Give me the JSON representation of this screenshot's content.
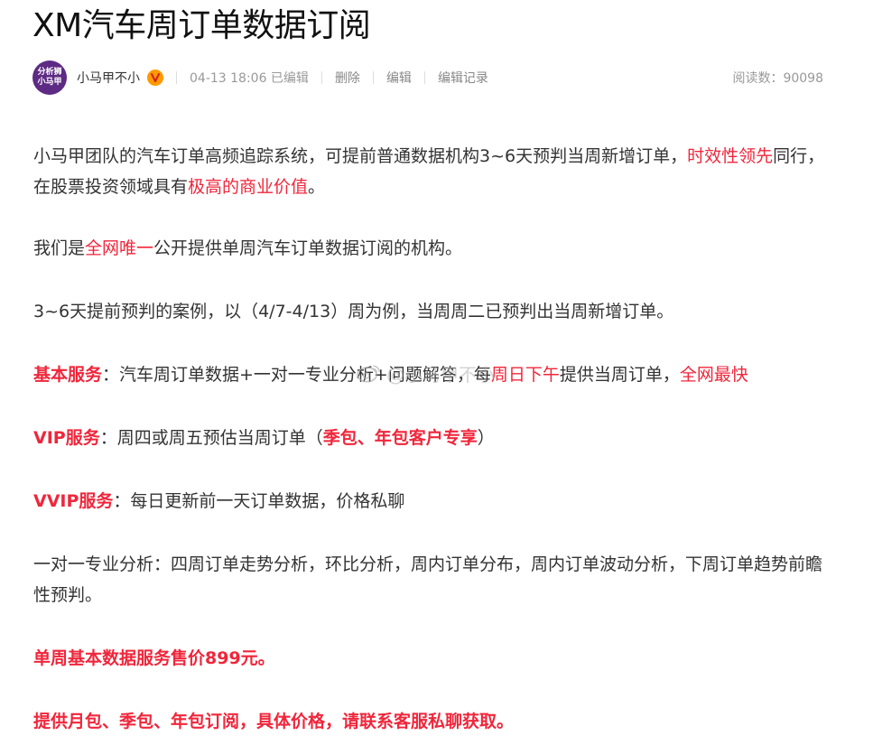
{
  "article": {
    "title": "XM汽车周订单数据订阅",
    "author": {
      "avatar_line1": "分析狮",
      "avatar_line2": "小马甲",
      "name": "小马甲不小"
    },
    "meta": {
      "date_status": "04-13 18:06 已编辑",
      "delete_label": "删除",
      "edit_label": "编辑",
      "history_label": "编辑记录",
      "read_count": "阅读数：90098"
    },
    "paragraph_1": {
      "part1": "小马甲团队的汽车订单高频追踪系统，可提前普通数据机构3~6天预判当周新增订单，",
      "highlight1": "时效性领先",
      "part2": "同行，在股票投资领域具有",
      "highlight2": "极高的商业价值",
      "part3": "。"
    },
    "paragraph_2": {
      "part1": "我们是",
      "highlight": "全网唯一",
      "part2": "公开提供单周汽车订单数据订阅的机构。"
    },
    "paragraph_3": {
      "text": "3~6天提前预判的案例，以（4/7-4/13）周为例，当周周二已预判出当周新增订单。"
    },
    "paragraph_4": {
      "label": "基本服务",
      "part1": "：汽车周订单数据+一对一专业分析+问题解答，每",
      "highlight1": "周日下午",
      "part2": "提供当周订单，",
      "highlight2": "全网最快"
    },
    "paragraph_5": {
      "label": "VIP服务",
      "part1": "：周四或周五预估当周订单（",
      "highlight": "季包、年包客户专享",
      "part2": "）"
    },
    "paragraph_6": {
      "label": "VVIP服务",
      "part1": "：每日更新前一天订单数据，价格私聊"
    },
    "paragraph_7": {
      "text": "一对一专业分析：四周订单走势分析，环比分析，周内订单分布，周内订单波动分析，下周订单趋势前瞻性预判。"
    },
    "paragraph_8": {
      "text": "单周基本数据服务售价899元。"
    },
    "paragraph_9": {
      "text": "提供月包、季包、年包订阅，具体价格，请联系客服私聊获取。"
    },
    "watermark": {
      "text": "@小马甲不小"
    }
  },
  "colors": {
    "accent_red": "#f0263b",
    "avatar_purple": "#5d2a84",
    "verified_orange": "#ff9a00"
  },
  "icons": {
    "verified": "verified-v-badge-icon",
    "watermark": "weibo-icon"
  }
}
